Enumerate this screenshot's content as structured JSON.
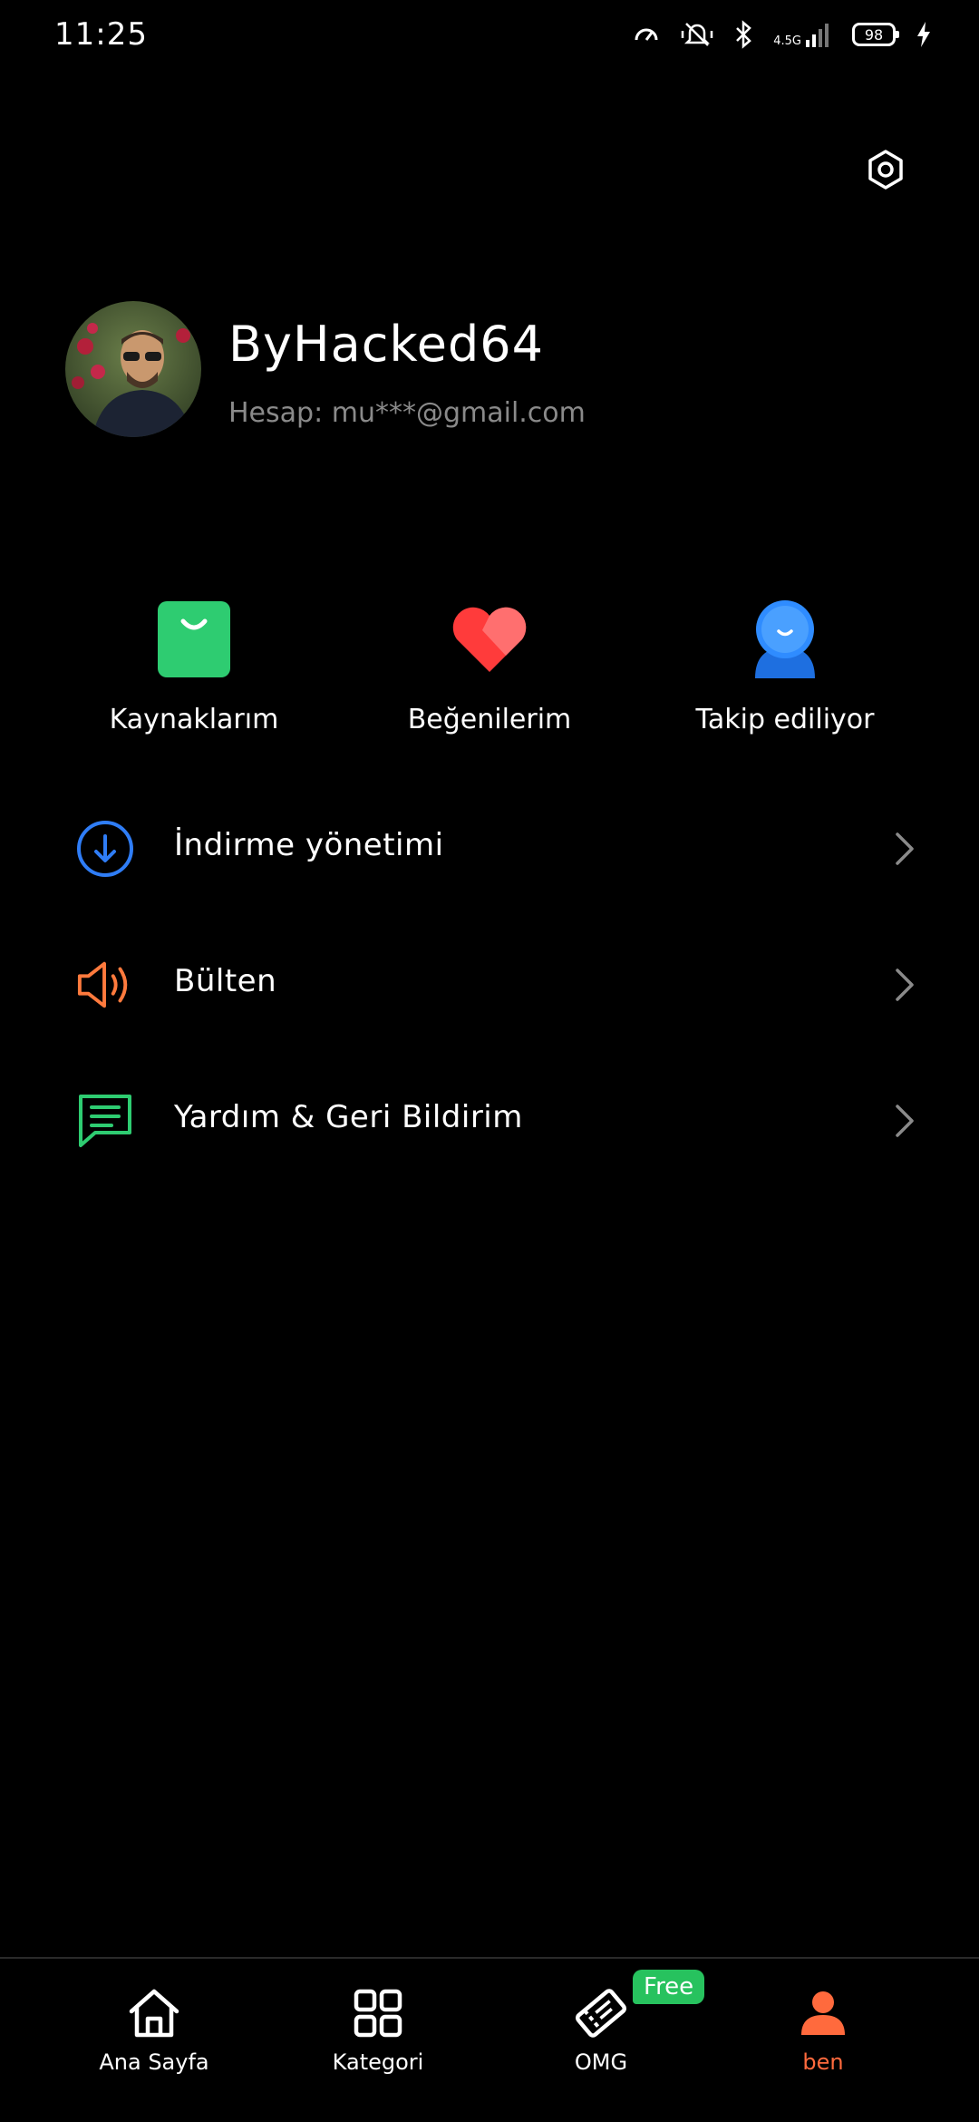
{
  "status_bar": {
    "time": "11:25",
    "network": "4.5G",
    "battery": "98"
  },
  "profile": {
    "name": "ByHacked64",
    "account": "Hesap: mu***@gmail.com"
  },
  "quick_actions": [
    {
      "label": "Kaynaklarım",
      "icon": "shopping-bag-icon",
      "color": "#2ecc71"
    },
    {
      "label": "Beğenilerim",
      "icon": "heart-icon",
      "color": "#ff3b3b"
    },
    {
      "label": "Takip ediliyor",
      "icon": "person-icon",
      "color": "#2f8cff"
    }
  ],
  "menu": [
    {
      "label": "İndirme yönetimi",
      "icon": "download-icon",
      "color": "#2f7df6"
    },
    {
      "label": "Bülten",
      "icon": "megaphone-icon",
      "color": "#ff7a3d"
    },
    {
      "label": "Yardım & Geri Bildirim",
      "icon": "chat-bubble-icon",
      "color": "#2ecc71"
    }
  ],
  "bottom_nav": {
    "items": [
      {
        "label": "Ana Sayfa",
        "icon": "home-icon",
        "active": false
      },
      {
        "label": "Kategori",
        "icon": "grid-icon",
        "active": false
      },
      {
        "label": "OMG",
        "icon": "ticket-icon",
        "active": false
      },
      {
        "label": "ben",
        "icon": "person-icon",
        "active": true
      }
    ],
    "free_badge": "Free",
    "active_color": "#ff6a3d"
  }
}
